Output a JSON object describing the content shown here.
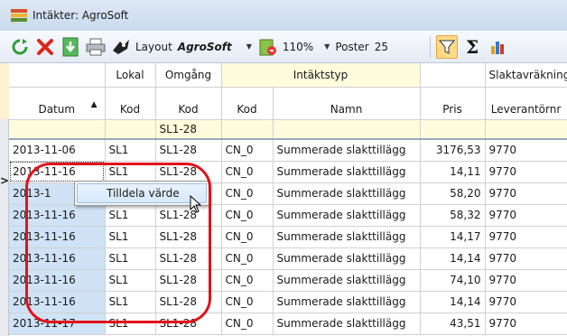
{
  "window": {
    "title": "Intäkter: AgroSoft"
  },
  "toolbar": {
    "layout_label": "Layout",
    "layout_name": "AgroSoft",
    "zoom": "110%",
    "poster_label": "Poster",
    "poster_value": "25",
    "icons": [
      "refresh-icon",
      "delete-icon",
      "export-icon",
      "print-icon",
      "layout-icon",
      "zoom-icon",
      "filter-icon",
      "sum-icon",
      "chart-icon"
    ]
  },
  "grid": {
    "group_headers": {
      "lokal": "Lokal",
      "omgang": "Omgång",
      "intaktstyp": "Intäktstyp",
      "slaktavrakning": "Slaktavräkning"
    },
    "columns": {
      "datum": "Datum",
      "lokal_kod": "Kod",
      "omgang_kod": "Kod",
      "typ_kod": "Kod",
      "namn": "Namn",
      "pris": "Pris",
      "leverantor": "Leverantörnr"
    },
    "filter": {
      "omgang_kod": "SL1-28"
    },
    "rows": [
      {
        "datum": "2013-11-06",
        "lokal": "SL1",
        "omgang": "SL1-28",
        "kod": "CN_0",
        "namn": "Summerade slakttillägg",
        "pris": "3176,53",
        "lev": "9770"
      },
      {
        "datum": "2013-11-16",
        "lokal": "SL1",
        "omgang": "SL1-28",
        "kod": "CN_0",
        "namn": "Summerade slakttillägg",
        "pris": "14,11",
        "lev": "9770"
      },
      {
        "datum": "2013-1",
        "lokal": "",
        "omgang": "SL1-28",
        "kod": "CN_0",
        "namn": "Summerade slakttillägg",
        "pris": "58,20",
        "lev": "9770"
      },
      {
        "datum": "2013-11-16",
        "lokal": "SL1",
        "omgang": "SL1-28",
        "kod": "CN_0",
        "namn": "Summerade slakttillägg",
        "pris": "58,32",
        "lev": "9770"
      },
      {
        "datum": "2013-11-16",
        "lokal": "SL1",
        "omgang": "SL1-28",
        "kod": "CN_0",
        "namn": "Summerade slakttillägg",
        "pris": "14,17",
        "lev": "9770"
      },
      {
        "datum": "2013-11-16",
        "lokal": "SL1",
        "omgang": "SL1-28",
        "kod": "CN_0",
        "namn": "Summerade slakttillägg",
        "pris": "14,14",
        "lev": "9770"
      },
      {
        "datum": "2013-11-16",
        "lokal": "SL1",
        "omgang": "SL1-28",
        "kod": "CN_0",
        "namn": "Summerade slakttillägg",
        "pris": "74,10",
        "lev": "9770"
      },
      {
        "datum": "2013-11-16",
        "lokal": "SL1",
        "omgang": "SL1-28",
        "kod": "CN_0",
        "namn": "Summerade slakttillägg",
        "pris": "14,14",
        "lev": "9770"
      },
      {
        "datum": "2013-11-17",
        "lokal": "SL1",
        "omgang": "SL1-28",
        "kod": "CN_0",
        "namn": "Summerade slakttillägg",
        "pris": "43,51",
        "lev": "9770"
      }
    ]
  },
  "context_menu": {
    "item": "Tilldela värde"
  },
  "colors": {
    "annotation": "#e2121a",
    "date_highlight": "#cfe2f6",
    "filter_row": "#fefcdc",
    "menu_hover": "#d6e8fb"
  }
}
